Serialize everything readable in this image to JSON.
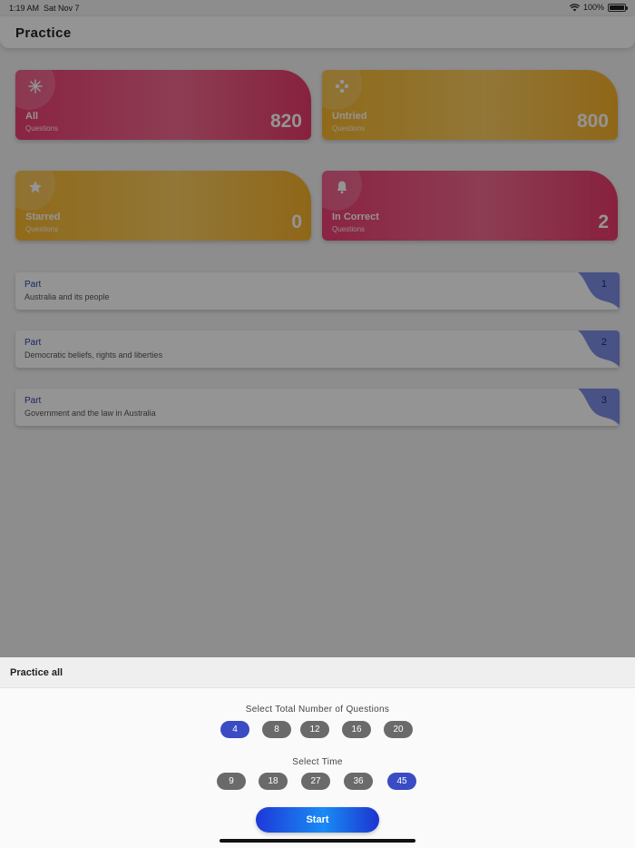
{
  "status_bar": {
    "time": "1:19 AM",
    "date": "Sat Nov 7",
    "battery": "100%"
  },
  "app_bar": {
    "title": "Practice"
  },
  "cards": [
    {
      "label": "All",
      "sub": "Questions",
      "count": "820",
      "icon": "snowflake-icon",
      "color": "#ee3e74"
    },
    {
      "label": "Untried",
      "sub": "Questions",
      "count": "800",
      "icon": "puzzle-icon",
      "color": "#f8b72e"
    },
    {
      "label": "Starred",
      "sub": "Questions",
      "count": "0",
      "icon": "star-icon",
      "color": "#f8b72e"
    },
    {
      "label": "In Correct",
      "sub": "Questions",
      "count": "2",
      "icon": "bell-icon",
      "color": "#ee3e74"
    }
  ],
  "parts": [
    {
      "label": "Part",
      "title": "Australia and its people",
      "number": "1"
    },
    {
      "label": "Part",
      "title": "Democratic beliefs, rights and liberties",
      "number": "2"
    },
    {
      "label": "Part",
      "title": "Government and the law in Australia",
      "number": "3"
    }
  ],
  "sheet": {
    "title": "Practice all",
    "questions_label": "Select Total Number of Questions",
    "question_options": [
      "4",
      "8",
      "12",
      "16",
      "20"
    ],
    "question_selected": "4",
    "time_label": "Select Time",
    "time_options": [
      "9",
      "18",
      "27",
      "36",
      "45"
    ],
    "time_selected": "45",
    "start_label": "Start"
  },
  "colors": {
    "accent": "#3a4bc4",
    "pink": "#ee3e74",
    "orange": "#f8b72e",
    "part_label": "#2b3ea8"
  }
}
